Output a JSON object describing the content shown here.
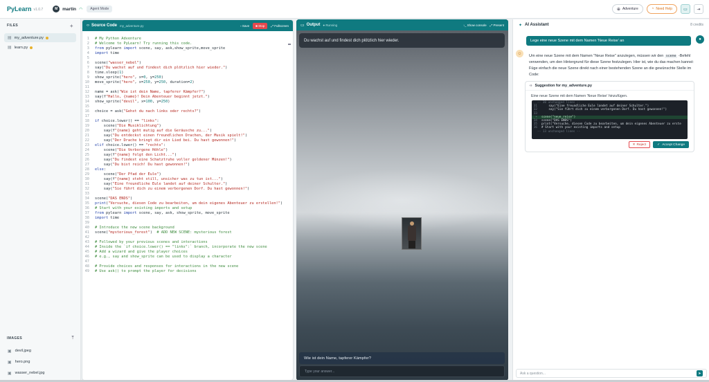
{
  "app": {
    "name": "PyLearn",
    "version": "v1.0.7"
  },
  "user": {
    "initial": "M",
    "name": "martin",
    "mode_badge": "Agent Mode"
  },
  "top_actions": {
    "adventure": "Adventure",
    "need_help": "Need Help"
  },
  "sidebar": {
    "files_header": "FILES",
    "files": [
      {
        "name": "my_adventure.py",
        "active": true
      },
      {
        "name": "learn.py",
        "active": false
      }
    ],
    "images_header": "IMAGES",
    "images": [
      "devil.jpeg",
      "hero.png",
      "wasser_nebel.jpg"
    ]
  },
  "code": {
    "title": "Source Code",
    "filename": "my_adventure.py",
    "save": "Save",
    "stop": "Stop",
    "fullscreen": "Fullscreen",
    "lines": [
      [
        [
          "c",
          "# My Python Adventure"
        ]
      ],
      [
        [
          "c",
          "# Welcome to PyLearn! Try running this code."
        ]
      ],
      [
        [
          "k",
          "from"
        ],
        [
          "t",
          " pylearn "
        ],
        [
          "k",
          "import"
        ],
        [
          "t",
          " scene, say, ask,show_sprite,move_sprite"
        ]
      ],
      [
        [
          "k",
          "import"
        ],
        [
          "t",
          " time"
        ]
      ],
      [],
      [
        [
          "t",
          "scene("
        ],
        [
          "s",
          "\"wasser_nebel\""
        ],
        [
          "t",
          ")"
        ]
      ],
      [
        [
          "t",
          "say("
        ],
        [
          "s",
          "\"Du wachst auf und findest dich plötzlich hier wieder.\""
        ],
        [
          "t",
          ")"
        ]
      ],
      [
        [
          "t",
          "time.sleep("
        ],
        [
          "n",
          "1"
        ],
        [
          "t",
          ")"
        ]
      ],
      [
        [
          "t",
          "show_sprite("
        ],
        [
          "s",
          "\"hero\""
        ],
        [
          "t",
          ", x="
        ],
        [
          "n",
          "0"
        ],
        [
          "t",
          ", y="
        ],
        [
          "n",
          "250"
        ],
        [
          "t",
          ")"
        ]
      ],
      [
        [
          "t",
          "move_sprite("
        ],
        [
          "s",
          "\"hero\""
        ],
        [
          "t",
          ", x="
        ],
        [
          "n",
          "250"
        ],
        [
          "t",
          ", y="
        ],
        [
          "n",
          "250"
        ],
        [
          "t",
          ", duration="
        ],
        [
          "n",
          "2"
        ],
        [
          "t",
          ")"
        ]
      ],
      [],
      [
        [
          "t",
          "name = ask("
        ],
        [
          "s",
          "\"Wie ist dein Name, tapferer Kämpfer?\""
        ],
        [
          "t",
          ")"
        ]
      ],
      [
        [
          "t",
          "say(f"
        ],
        [
          "s",
          "\"Hallo, {name}! Dein Abenteuer beginnt jetzt.\""
        ],
        [
          "t",
          ")"
        ]
      ],
      [
        [
          "t",
          "show_sprite("
        ],
        [
          "s",
          "\"devil\""
        ],
        [
          "t",
          ", x="
        ],
        [
          "n",
          "100"
        ],
        [
          "t",
          ", y="
        ],
        [
          "n",
          "250"
        ],
        [
          "t",
          ")"
        ]
      ],
      [],
      [
        [
          "t",
          "choice = ask("
        ],
        [
          "s",
          "\"Gehst du nach links oder rechts?\""
        ],
        [
          "t",
          ")"
        ]
      ],
      [],
      [
        [
          "k",
          "if"
        ],
        [
          "t",
          " choice.lower() == "
        ],
        [
          "s",
          "\"links\""
        ],
        [
          "t",
          ":"
        ]
      ],
      [
        [
          "t",
          "    scene("
        ],
        [
          "s",
          "\"Die Musiklichtung\""
        ],
        [
          "t",
          ")"
        ]
      ],
      [
        [
          "t",
          "    say(f"
        ],
        [
          "s",
          "\"{name} geht mutig auf die Geräusche zu...\""
        ],
        [
          "t",
          ")"
        ]
      ],
      [
        [
          "t",
          "    say("
        ],
        [
          "s",
          "\"Du entdeckst einen freundlichen Drachen, der Musik spielt!\""
        ],
        [
          "t",
          ")"
        ]
      ],
      [
        [
          "t",
          "    say("
        ],
        [
          "s",
          "\"Der Drache bringt dir ein Lied bei. Du hast gewonnen!\""
        ],
        [
          "t",
          ")"
        ]
      ],
      [
        [
          "k",
          "elif"
        ],
        [
          "t",
          " choice.lower() == "
        ],
        [
          "s",
          "\"rechts\""
        ],
        [
          "t",
          ":"
        ]
      ],
      [
        [
          "t",
          "    scene("
        ],
        [
          "s",
          "\"Die Verborgene Höhle\""
        ],
        [
          "t",
          ")"
        ]
      ],
      [
        [
          "t",
          "    say(f"
        ],
        [
          "s",
          "\"{name} folgt den Licht...\""
        ],
        [
          "t",
          ")"
        ]
      ],
      [
        [
          "t",
          "    say("
        ],
        [
          "s",
          "\"Du findest eine Schatztruhe voller goldener Münzen!\""
        ],
        [
          "t",
          ")"
        ]
      ],
      [
        [
          "t",
          "    say("
        ],
        [
          "s",
          "\"Du bist reich! Du hast gewonnen!\""
        ],
        [
          "t",
          ")"
        ]
      ],
      [
        [
          "k",
          "else"
        ],
        [
          "t",
          ":"
        ]
      ],
      [
        [
          "t",
          "    scene("
        ],
        [
          "s",
          "\"Der Pfad der Eule\""
        ],
        [
          "t",
          ")"
        ]
      ],
      [
        [
          "t",
          "    say(f"
        ],
        [
          "s",
          "\"{name} steht still, unsicher was zu tun ist...\""
        ],
        [
          "t",
          ")"
        ]
      ],
      [
        [
          "t",
          "    say("
        ],
        [
          "s",
          "\"Eine freundliche Eule landet auf deiner Schulter.\""
        ],
        [
          "t",
          ")"
        ]
      ],
      [
        [
          "t",
          "    say("
        ],
        [
          "s",
          "\"Sie führt dich zu einem verborgenen Dorf. Du hast gewonnen!\""
        ],
        [
          "t",
          ")"
        ]
      ],
      [],
      [
        [
          "t",
          "scene("
        ],
        [
          "s",
          "\"DAS ENDS\""
        ],
        [
          "t",
          ")"
        ]
      ],
      [
        [
          "k",
          "print"
        ],
        [
          "t",
          "("
        ],
        [
          "s",
          "\"Versuche, diesen Code zu bearbeiten, um dein eigenes Abenteuer zu erstellen!\""
        ],
        [
          "t",
          ")"
        ]
      ],
      [
        [
          "c",
          "# Start with your existing imports and setup"
        ]
      ],
      [
        [
          "k",
          "from"
        ],
        [
          "t",
          " pylearn "
        ],
        [
          "k",
          "import"
        ],
        [
          "t",
          " scene, say, ask, show_sprite, move_sprite"
        ]
      ],
      [
        [
          "k",
          "import"
        ],
        [
          "t",
          " time"
        ]
      ],
      [],
      [
        [
          "c",
          "# Introduce the new scene background"
        ]
      ],
      [
        [
          "t",
          "scene("
        ],
        [
          "s",
          "\"mysterious_forest\""
        ],
        [
          "t",
          ")  "
        ],
        [
          "c",
          "# ADD NEW SCENE: mysterious forest"
        ]
      ],
      [],
      [
        [
          "c",
          "# Followed by your previous scenes and interactions"
        ]
      ],
      [
        [
          "c",
          "# Inside the `if choice.lower() == \"links\":` branch, incorporate the new scene"
        ]
      ],
      [
        [
          "c",
          "# Add a wizard and give the player choices"
        ]
      ],
      [
        [
          "c",
          "# e.g., say and show_sprite can be used to display a character"
        ]
      ],
      [],
      [
        [
          "c",
          "# Provide choices and responses for interactions in the new scene"
        ]
      ],
      [
        [
          "c",
          "# Use ask() to prompt the player for decisions"
        ]
      ]
    ]
  },
  "output": {
    "title": "Output",
    "status": "Running",
    "show_console": "Show console",
    "present": "Present",
    "narration": "Du wachst auf und findest dich plötzlich hier wieder.",
    "question": "Wie ist dein Name, tapferer Kämpfer?",
    "answer_placeholder": "Type your answer..."
  },
  "ai": {
    "title": "AI Assistant",
    "credits": "8 credits",
    "user_message": "Lege eine neue Szene mit dem Namen 'Neue Reise' an",
    "bot_text_1": "Um eine neue Szene mit dem Namen \"Neue Reise\" anzulegen, müssen wir den",
    "bot_code": "scene",
    "bot_text_2": "-Befehl verwenden, um den Hintergrund für diese Szene festzulegen. Hier ist, wie du das machen kannst: Füge einfach die neue Szene direkt nach einer bestehenden Szene an die gewünschte Stelle im Code:",
    "suggestion_title": "Suggestion for my_adventure.py",
    "suggestion_desc": "Eine neue Szene mit dem Namen 'Neue Reise' hinzufügen.",
    "diff": [
      {
        "kind": "un",
        "num": "",
        "text": "-- 30 unchanged lines --"
      },
      {
        "kind": "ctx",
        "num": "31",
        "text": "    say(\"Eine freundliche Eule landet auf deiner Schulter.\")"
      },
      {
        "kind": "ctx",
        "num": "32",
        "text": "    say(\"Sie führt dich zu einem verborgenen Dorf. Du hast gewonnen!\")"
      },
      {
        "kind": "ctx",
        "num": "33",
        "text": ""
      },
      {
        "kind": "add",
        "num": "+",
        "text": "scene(\"neue_reise\")"
      },
      {
        "kind": "ctx",
        "num": "34",
        "text": "scene(\"DAS ENDS\")"
      },
      {
        "kind": "ctx",
        "num": "35",
        "text": "print(\"Versuche, diesen Code zu bearbeiten, um dein eigenes Abenteuer zu erste"
      },
      {
        "kind": "ctx",
        "num": "36",
        "text": "# Start with your existing imports and setup"
      },
      {
        "kind": "un",
        "num": "",
        "text": "-- 13 unchanged lines --"
      }
    ],
    "reject": "Reject",
    "accept": "Accept Change",
    "input_placeholder": "Ask a question..."
  }
}
